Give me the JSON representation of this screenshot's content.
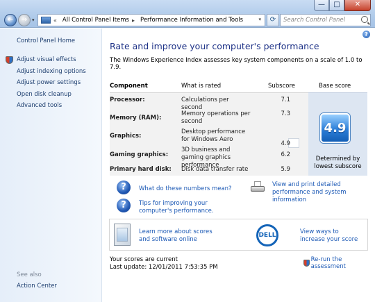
{
  "window": {
    "controls": {
      "minimize": "—",
      "maximize": "□",
      "close": "✕"
    }
  },
  "toolbar": {
    "back": "←",
    "forward": "→",
    "breadcrumb": [
      "All Control Panel Items",
      "Performance Information and Tools"
    ],
    "search_placeholder": "Search Control Panel"
  },
  "sidebar": {
    "home": "Control Panel Home",
    "items": [
      {
        "label": "Adjust visual effects",
        "icon": "shield-icon"
      },
      {
        "label": "Adjust indexing options"
      },
      {
        "label": "Adjust power settings"
      },
      {
        "label": "Open disk cleanup"
      },
      {
        "label": "Advanced tools"
      }
    ],
    "see_also": "See also",
    "see_also_items": [
      "Action Center"
    ]
  },
  "main": {
    "title": "Rate and improve your computer's performance",
    "description": "The Windows Experience Index assesses key system components on a scale of 1.0 to 7.9.",
    "table": {
      "headers": {
        "component": "Component",
        "rated": "What is rated",
        "subscore": "Subscore",
        "base": "Base score"
      },
      "rows": [
        {
          "component": "Processor:",
          "rated": "Calculations per second",
          "subscore": "7.1"
        },
        {
          "component": "Memory (RAM):",
          "rated": "Memory operations per second",
          "subscore": "7.3"
        },
        {
          "component": "Graphics:",
          "rated": "Desktop performance for Windows Aero",
          "subscore": "4.9"
        },
        {
          "component": "Gaming graphics:",
          "rated": "3D business and gaming graphics performance",
          "subscore": "6.2"
        },
        {
          "component": "Primary hard disk:",
          "rated": "Disk data transfer rate",
          "subscore": "5.9"
        }
      ],
      "base_score": "4.9",
      "base_note": "Determined by lowest subscore"
    },
    "links": {
      "numbers": "What do these numbers mean?",
      "tips": "Tips for improving your computer's performance.",
      "print": "View and print detailed performance and system information",
      "learn": "Learn more about scores and software online",
      "increase": "View ways to increase your score",
      "dell_logo": "DELL"
    },
    "status": {
      "current": "Your scores are current",
      "last_update": "Last update: 12/01/2011 7:53:35 PM",
      "rerun": "Re-run the assessment"
    }
  },
  "colors": {
    "title": "#1e3287",
    "link": "#1c59b5",
    "badge": "#2b7ed8"
  }
}
